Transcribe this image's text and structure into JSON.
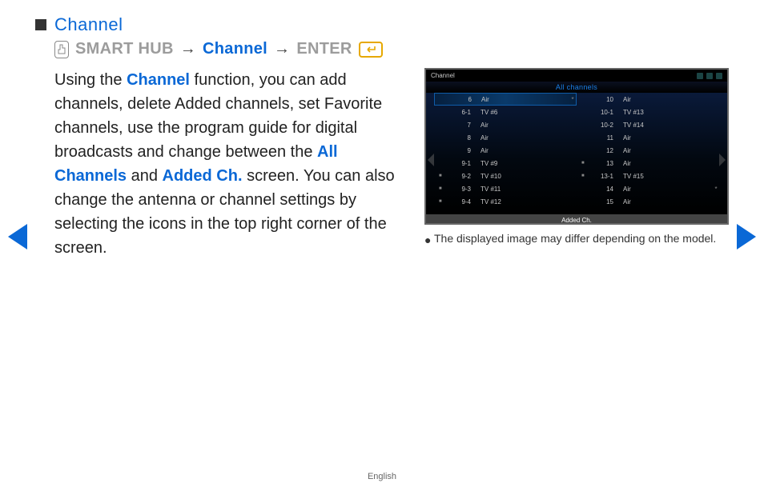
{
  "heading": "Channel",
  "path": {
    "step1": "SMART HUB",
    "arrow": "→",
    "step2": "Channel",
    "step3": "ENTER"
  },
  "body": {
    "t1": "Using the ",
    "link1": "Channel",
    "t2": " function, you can add channels, delete Added channels, set Favorite channels, use the program guide for digital broadcasts and change between the ",
    "link2": "All Channels",
    "t3": " and ",
    "link3": "Added Ch.",
    "t4": " screen. You can also change the antenna or channel settings by selecting the icons in the top right corner of the screen."
  },
  "tv": {
    "title": "Channel",
    "tab": "All channels",
    "footer": "Added Ch.",
    "left": [
      {
        "num": "6",
        "name": "Air",
        "sel": true,
        "tick": "*"
      },
      {
        "num": "6-1",
        "name": "TV #6"
      },
      {
        "num": "7",
        "name": "Air"
      },
      {
        "num": "8",
        "name": "Air"
      },
      {
        "num": "9",
        "name": "Air"
      },
      {
        "num": "9-1",
        "name": "TV #9"
      },
      {
        "num": "9-2",
        "name": "TV #10",
        "mark": true
      },
      {
        "num": "9-3",
        "name": "TV #11",
        "mark": true
      },
      {
        "num": "9-4",
        "name": "TV #12",
        "mark": true
      }
    ],
    "right": [
      {
        "num": "10",
        "name": "Air"
      },
      {
        "num": "10-1",
        "name": "TV #13"
      },
      {
        "num": "10-2",
        "name": "TV #14"
      },
      {
        "num": "11",
        "name": "Air"
      },
      {
        "num": "12",
        "name": "Air"
      },
      {
        "num": "13",
        "name": "Air",
        "mark": true
      },
      {
        "num": "13-1",
        "name": "TV #15",
        "mark": true
      },
      {
        "num": "14",
        "name": "Air",
        "tick": "*"
      },
      {
        "num": "15",
        "name": "Air"
      }
    ]
  },
  "caption": "The displayed image may differ depending on the model.",
  "language": "English"
}
